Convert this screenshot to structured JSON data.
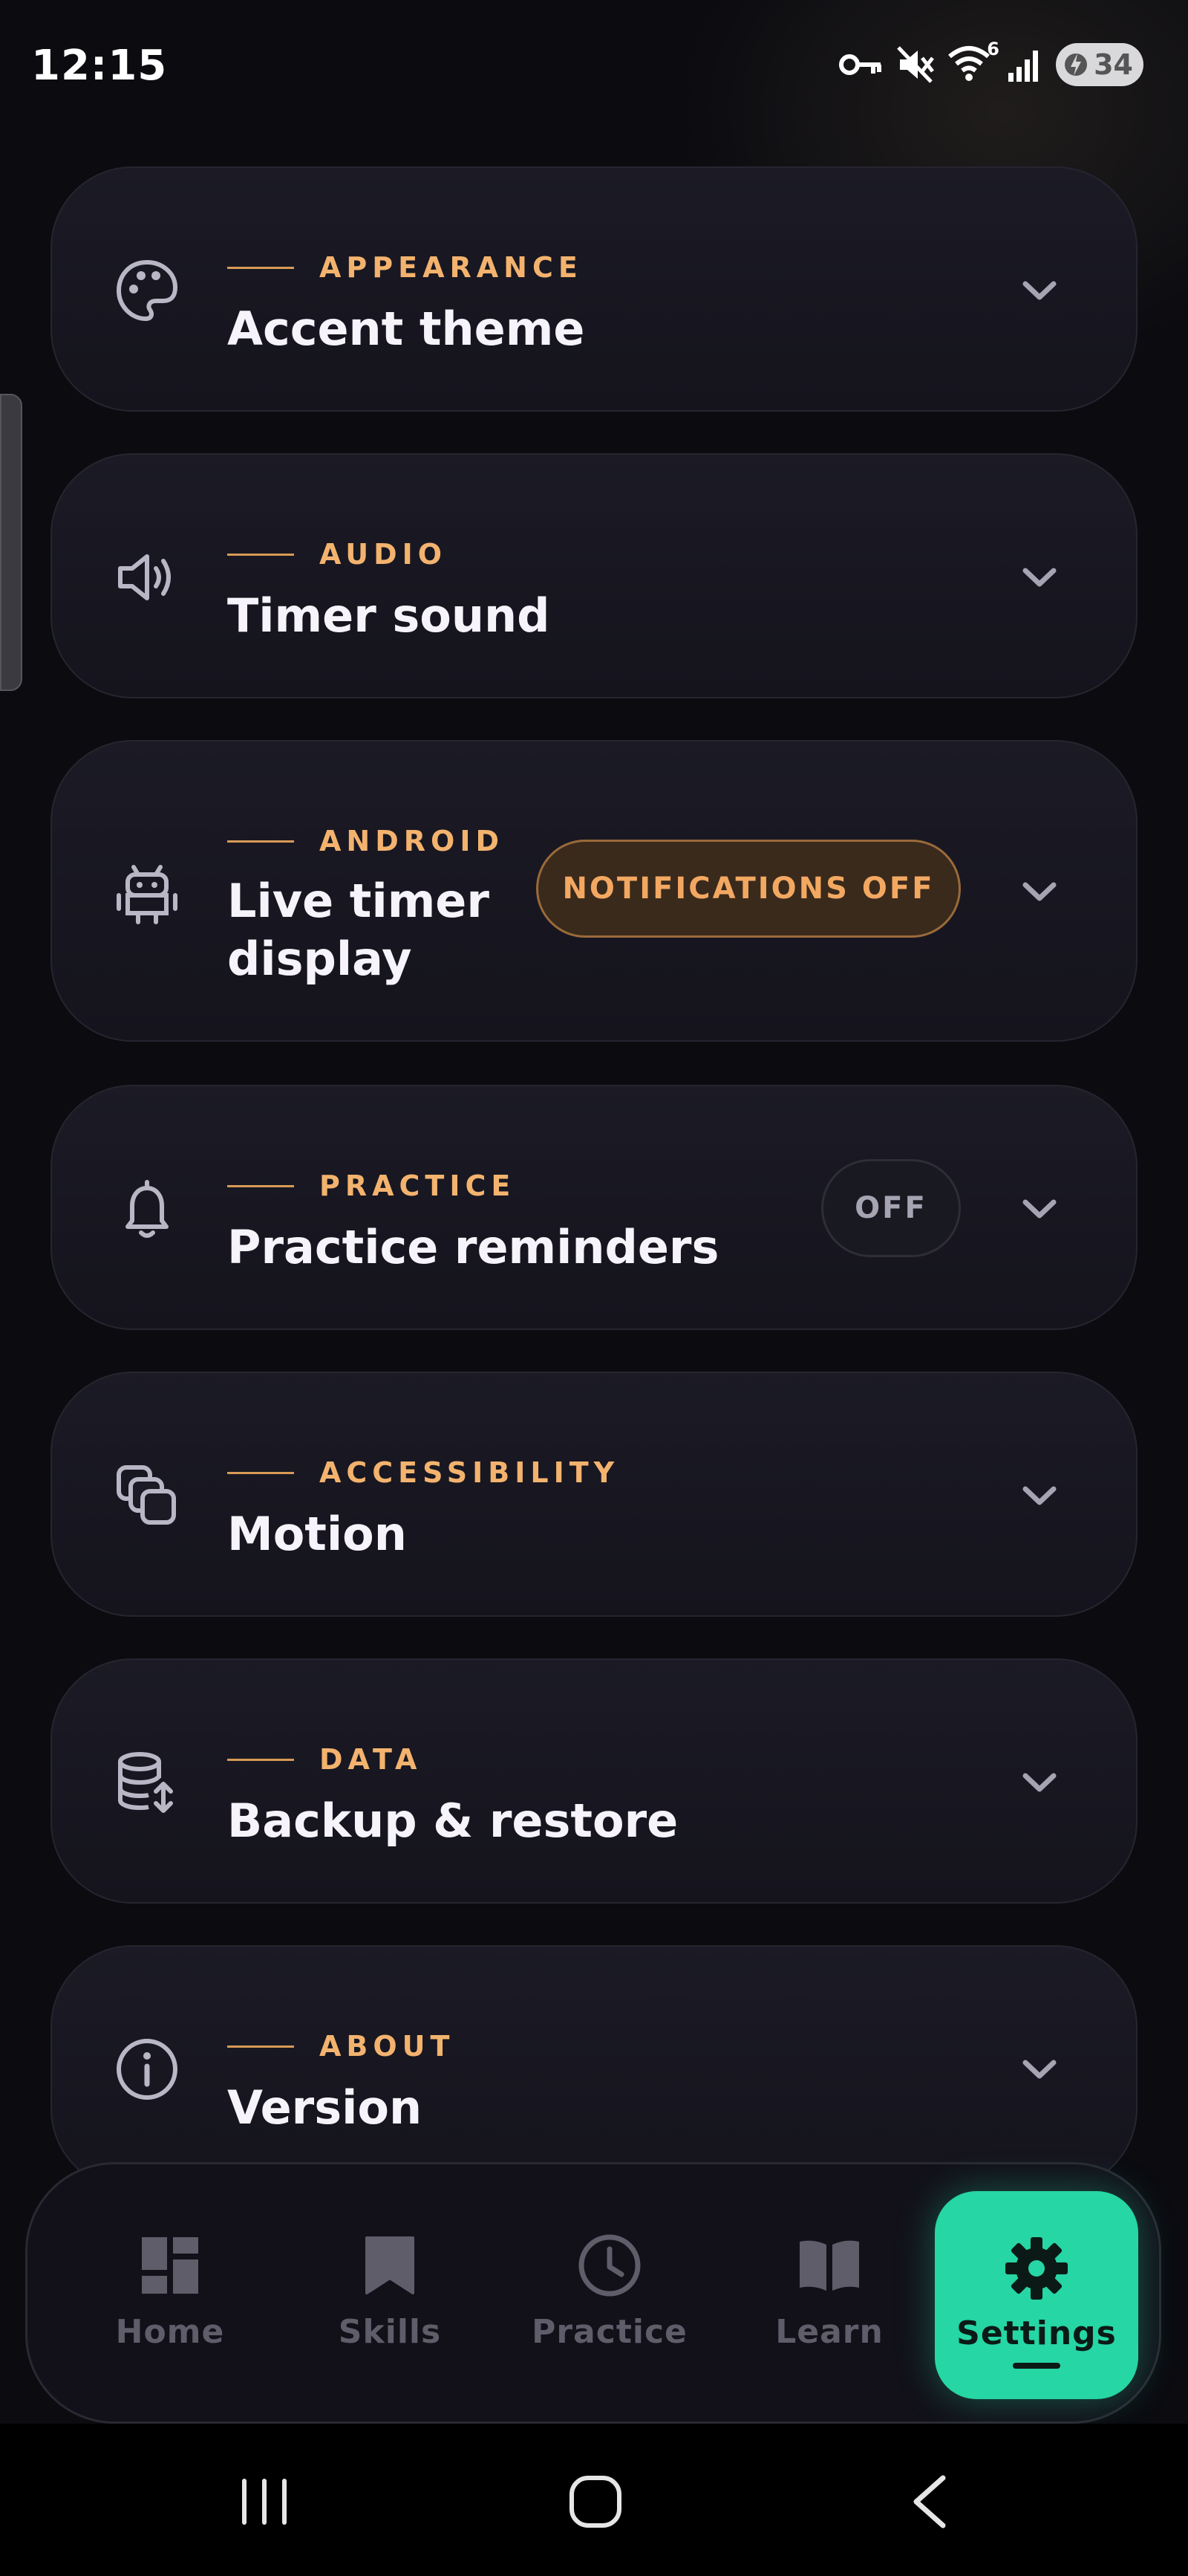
{
  "status_bar": {
    "time": "12:15",
    "icons": [
      "vpn-key-icon",
      "mute-icon",
      "wifi-icon",
      "signal-icon"
    ],
    "wifi_badge": "6",
    "battery_level": "34"
  },
  "colors": {
    "background": "#0b0b10",
    "card": "#1b1a25",
    "accent_orange": "#f3b36e",
    "active_tab": "#26d6a5"
  },
  "settings": [
    {
      "category": "APPEARANCE",
      "title": "Accent theme",
      "icon": "palette-icon"
    },
    {
      "category": "AUDIO",
      "title": "Timer sound",
      "icon": "speaker-icon"
    },
    {
      "category": "ANDROID",
      "title": "Live timer display",
      "icon": "android-icon",
      "badge": "NOTIFICATIONS OFF"
    },
    {
      "category": "PRACTICE",
      "title": "Practice reminders",
      "icon": "bell-icon",
      "badge": "OFF"
    },
    {
      "category": "ACCESSIBILITY",
      "title": "Motion",
      "icon": "motion-icon"
    },
    {
      "category": "DATA",
      "title": "Backup & restore",
      "icon": "database-icon"
    },
    {
      "category": "ABOUT",
      "title": "Version",
      "icon": "info-icon"
    }
  ],
  "bottom_nav": {
    "items": [
      {
        "label": "Home",
        "icon": "dashboard-icon"
      },
      {
        "label": "Skills",
        "icon": "bookmark-icon"
      },
      {
        "label": "Practice",
        "icon": "clock-icon"
      },
      {
        "label": "Learn",
        "icon": "book-icon"
      },
      {
        "label": "Settings",
        "icon": "gear-icon",
        "active": true
      }
    ]
  },
  "system_nav": [
    "recents-icon",
    "home-icon",
    "back-icon"
  ]
}
